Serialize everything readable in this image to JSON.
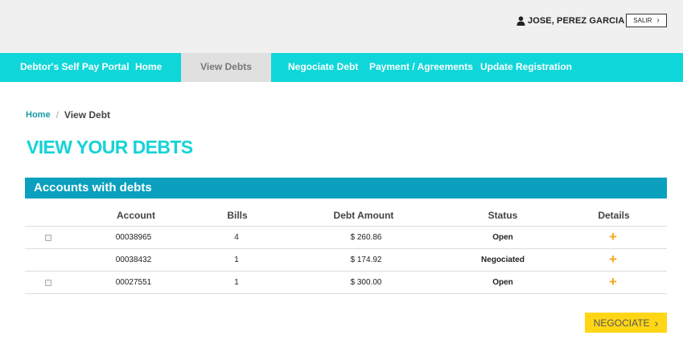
{
  "header": {
    "user_name": "JOSE, PEREZ GARCIA",
    "logout_label": "SALIR"
  },
  "nav": {
    "brand": "Debtor's Self Pay Portal",
    "home": "Home",
    "view_debts": "View Debts",
    "negotiate": "Negociate Debt",
    "payments": "Payment / Agreements",
    "update": "Update Registration"
  },
  "breadcrumb": {
    "home": "Home",
    "separator": "/",
    "current": "View Debt"
  },
  "page_title": "VIEW YOUR DEBTS",
  "panel_title": "Accounts with debts",
  "table": {
    "columns": [
      "Account",
      "Bills",
      "Debt Amount",
      "Status",
      "Details"
    ],
    "rows": [
      {
        "account": "00038965",
        "bills": "4",
        "amount": "$ 260.86",
        "status": "Open",
        "selectable": true
      },
      {
        "account": "00038432",
        "bills": "1",
        "amount": "$ 174.92",
        "status": "Negociated",
        "selectable": false
      },
      {
        "account": "00027551",
        "bills": "1",
        "amount": "$ 300.00",
        "status": "Open",
        "selectable": true
      }
    ],
    "details_icon": "plus-icon"
  },
  "negotiate_button": "NEGOCIATE",
  "colors": {
    "nav": "#0fd6d9",
    "title": "#15d3d7",
    "panel": "#0aa0be",
    "plus": "#f5a623",
    "button": "#ffd616"
  }
}
